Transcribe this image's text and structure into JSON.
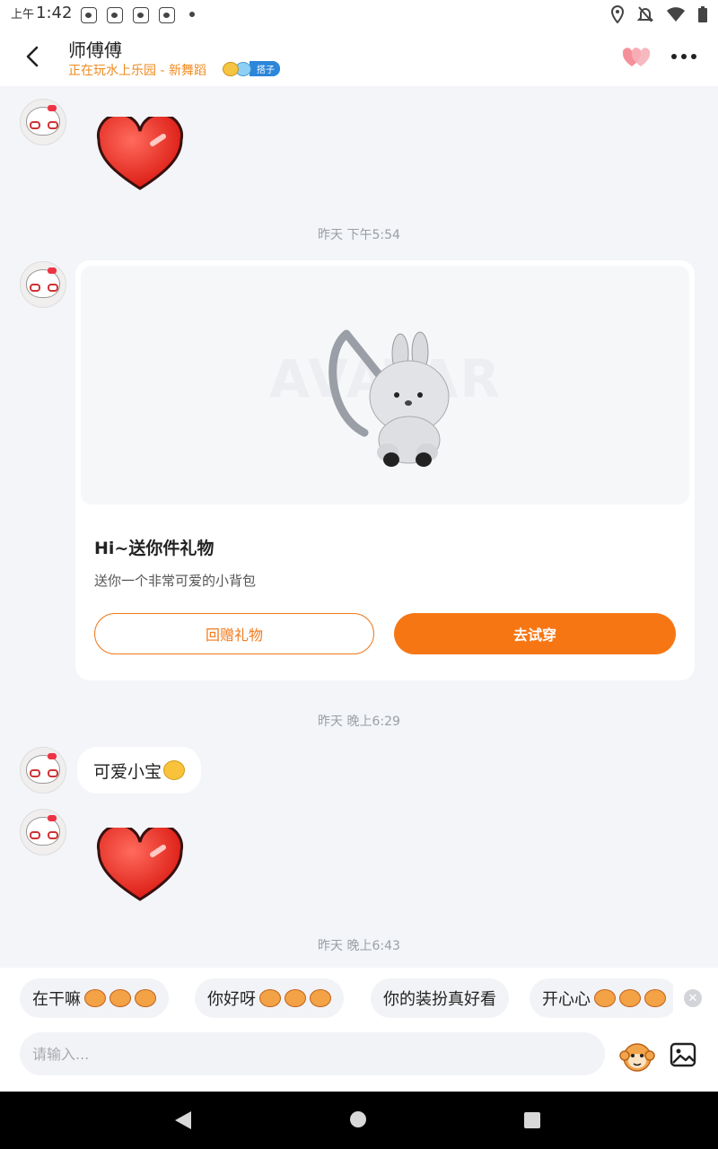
{
  "status_bar": {
    "ampm": "上午",
    "time": "1:42",
    "notification_icons": [
      "paw-icon",
      "paw-icon",
      "paw-icon",
      "paw-icon"
    ],
    "right_icons": [
      "location-icon",
      "bell-off-icon",
      "wifi-icon",
      "battery-icon"
    ]
  },
  "header": {
    "title": "师傅傅",
    "subtitle": "正在玩水上乐园 - 新舞蹈",
    "badge_label": "搭子",
    "accent_color": "#f08a1e"
  },
  "messages": {
    "timestamp_1": "昨天 下午5:54",
    "timestamp_2": "昨天 晚上6:29",
    "timestamp_3": "昨天 晚上6:43",
    "text_bubble": "可爱小宝",
    "stickers": [
      "heart-sticker",
      "heart-sticker"
    ]
  },
  "gift_card": {
    "title": "Hi~送你件礼物",
    "description": "送你一个非常可爱的小背包",
    "watermark": "AVATAR",
    "return_button": "回赠礼物",
    "try_button": "去试穿",
    "button_color": "#f77614"
  },
  "quick_replies": [
    {
      "label": "在干嘛"
    },
    {
      "label": "你好呀"
    },
    {
      "label": "你的装扮真好看"
    },
    {
      "label": "开心心"
    }
  ],
  "composer": {
    "placeholder": "请输入..."
  }
}
